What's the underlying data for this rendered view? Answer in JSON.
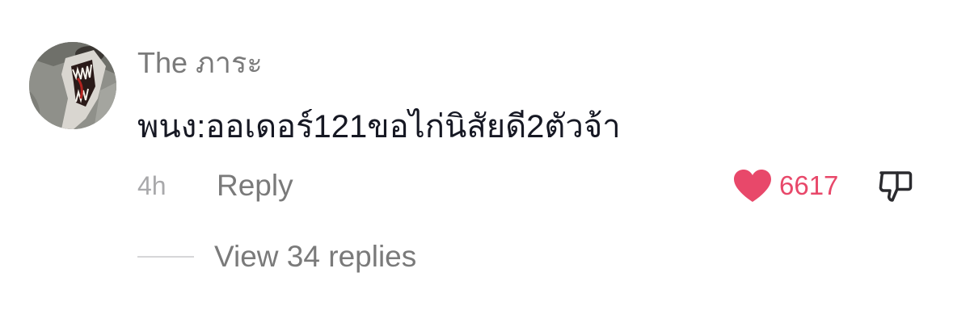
{
  "comment": {
    "avatar_icon": "creature-profile-photo",
    "username": "The ภาระ",
    "text": "พนง:ออเดอร์121ขอไก่นิสัยดี2ตัวจ้า",
    "time": "4h",
    "reply_label": "Reply",
    "like_icon": "heart-icon",
    "like_color": "#e8486a",
    "like_count": "6617",
    "dislike_icon": "thumbs-down-icon",
    "view_replies_label": "View 34 replies"
  }
}
